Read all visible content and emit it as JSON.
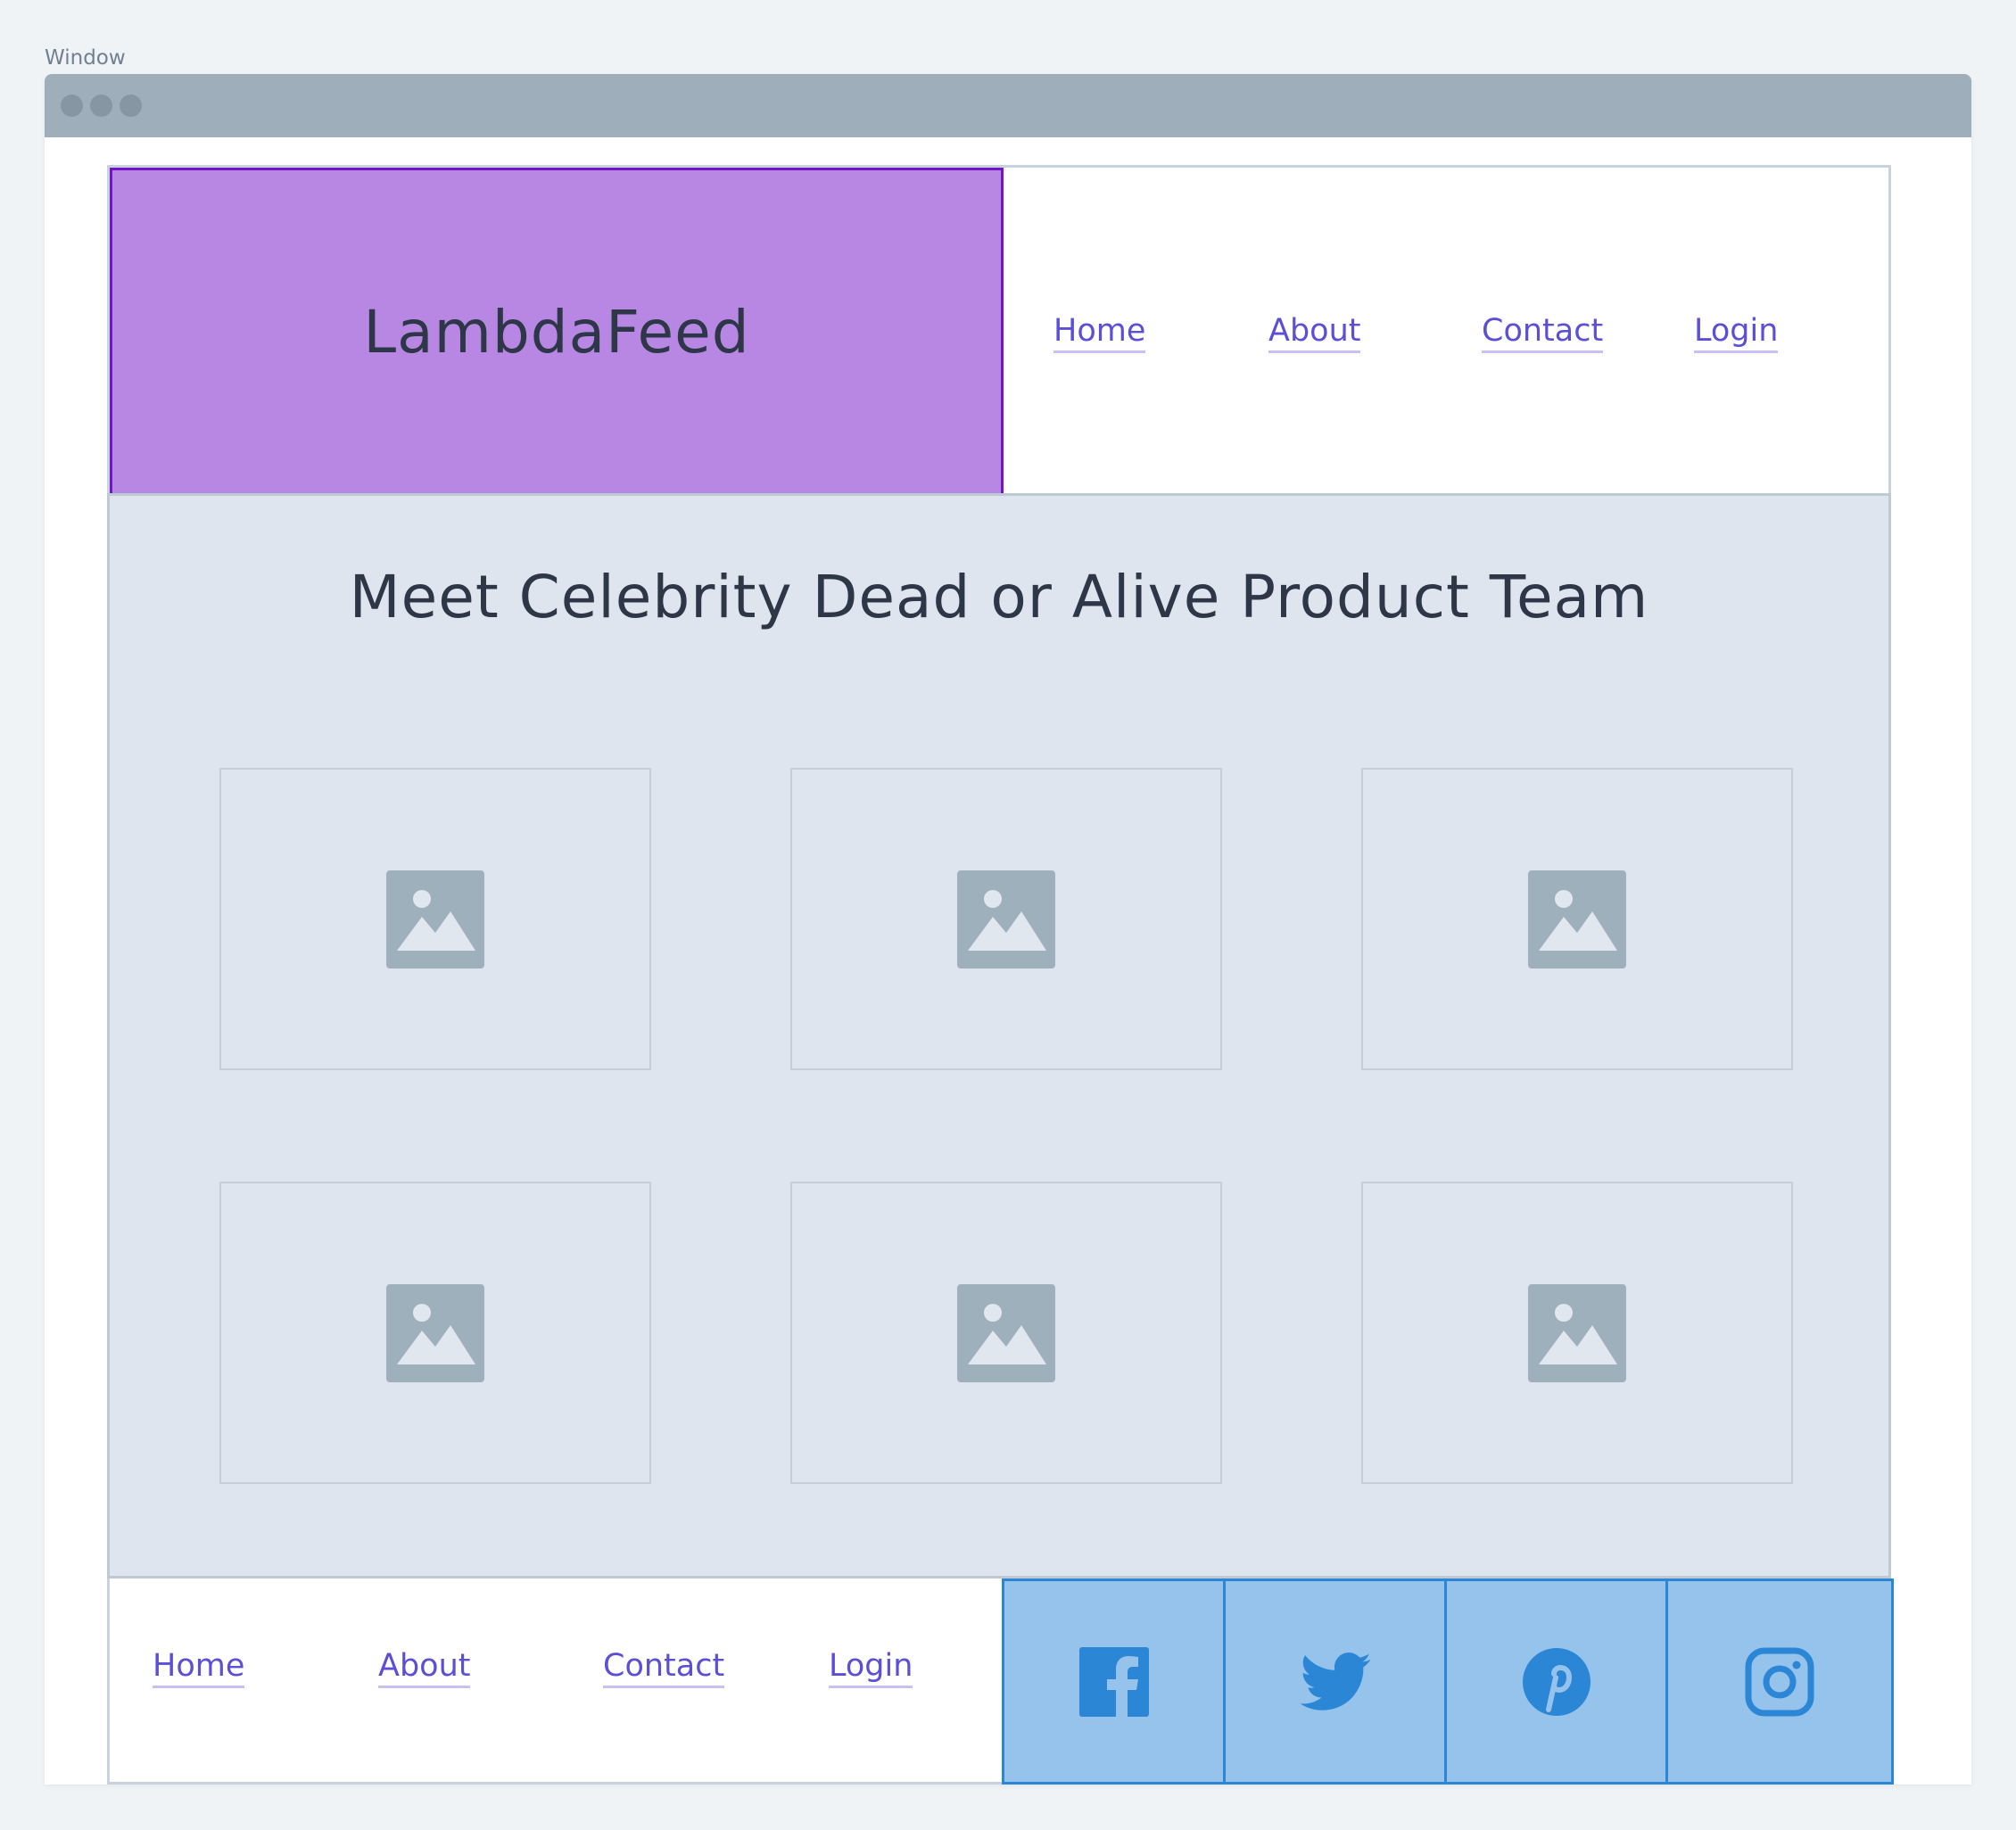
{
  "window": {
    "label": "Window"
  },
  "header": {
    "logo": "LambdaFeed",
    "nav": [
      {
        "label": "Home"
      },
      {
        "label": "About"
      },
      {
        "label": "Contact"
      },
      {
        "label": "Login"
      }
    ]
  },
  "hero": {
    "title": "Meet Celebrity Dead or Alive Product Team",
    "images": [
      "image-placeholder",
      "image-placeholder",
      "image-placeholder",
      "image-placeholder",
      "image-placeholder",
      "image-placeholder"
    ]
  },
  "footer": {
    "nav": [
      {
        "label": "Home"
      },
      {
        "label": "About"
      },
      {
        "label": "Contact"
      },
      {
        "label": "Login"
      }
    ],
    "social": [
      "facebook-icon",
      "twitter-icon",
      "pinterest-icon",
      "instagram-icon"
    ]
  },
  "colors": {
    "logo_bg": "#b887e3",
    "logo_border": "#7215c8",
    "link": "#5b4fd6",
    "social_bg": "#96c3eb",
    "social_accent": "#2b86d6",
    "hero_bg": "#dfe5ee"
  }
}
